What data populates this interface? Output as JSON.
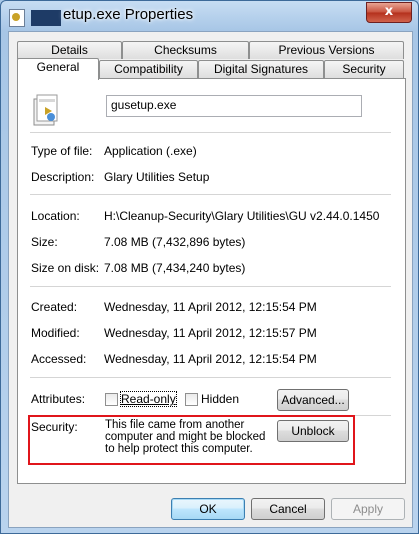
{
  "window": {
    "title": "etup.exe Properties",
    "close_label": "x"
  },
  "tabs_row1": [
    {
      "label": "Details"
    },
    {
      "label": "Checksums"
    },
    {
      "label": "Previous Versions"
    }
  ],
  "tabs_row2": [
    {
      "label": "General",
      "active": true
    },
    {
      "label": "Compatibility"
    },
    {
      "label": "Digital Signatures"
    },
    {
      "label": "Security"
    }
  ],
  "general": {
    "file_name": "gusetup.exe",
    "type_label": "Type of file:",
    "type_value": "Application (.exe)",
    "description_label": "Description:",
    "description_value": "Glary Utilities Setup",
    "location_label": "Location:",
    "location_value": "H:\\Cleanup-Security\\Glary Utilities\\GU v2.44.0.1450",
    "size_label": "Size:",
    "size_value": "7.08 MB (7,432,896 bytes)",
    "size_on_disk_label": "Size on disk:",
    "size_on_disk_value": "7.08 MB (7,434,240 bytes)",
    "created_label": "Created:",
    "created_value": "Wednesday, 11 April 2012, 12:15:54 PM",
    "modified_label": "Modified:",
    "modified_value": "Wednesday, 11 April 2012, 12:15:57 PM",
    "accessed_label": "Accessed:",
    "accessed_value": "Wednesday, 11 April 2012, 12:15:54 PM",
    "attributes_label": "Attributes:",
    "readonly_label": "Read-only",
    "hidden_label": "Hidden",
    "advanced_label": "Advanced...",
    "security_label": "Security:",
    "security_text": "This file came from another computer and might be blocked to help protect this computer.",
    "unblock_label": "Unblock"
  },
  "buttons": {
    "ok": "OK",
    "cancel": "Cancel",
    "apply": "Apply"
  },
  "colors": {
    "highlight": "#e0151b",
    "window_frame": "#a9c8e8"
  }
}
